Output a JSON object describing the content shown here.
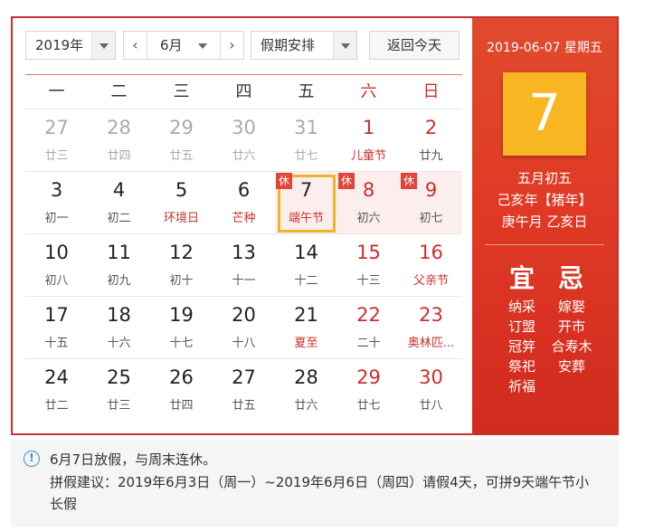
{
  "toolbar": {
    "year": "2019年",
    "month": "6月",
    "prev_icon": "‹",
    "next_icon": "›",
    "holiday": "假期安排",
    "today_button": "返回今天"
  },
  "weekdays": [
    "一",
    "二",
    "三",
    "四",
    "五",
    "六",
    "日"
  ],
  "weeks": [
    [
      {
        "num": "27",
        "sub": "廿三",
        "other": true
      },
      {
        "num": "28",
        "sub": "廿四",
        "other": true
      },
      {
        "num": "29",
        "sub": "廿五",
        "other": true
      },
      {
        "num": "30",
        "sub": "廿六",
        "other": true
      },
      {
        "num": "31",
        "sub": "廿七",
        "other": true
      },
      {
        "num": "1",
        "sub": "儿童节",
        "weekend": true,
        "festival": true
      },
      {
        "num": "2",
        "sub": "廿九",
        "weekend": true
      }
    ],
    [
      {
        "num": "3",
        "sub": "初一"
      },
      {
        "num": "4",
        "sub": "初二"
      },
      {
        "num": "5",
        "sub": "环境日",
        "festival": true
      },
      {
        "num": "6",
        "sub": "芒种",
        "festival": true
      },
      {
        "num": "7",
        "sub": "端午节",
        "festival": true,
        "tag": "休",
        "rest": true,
        "selected": true
      },
      {
        "num": "8",
        "sub": "初六",
        "weekend": true,
        "tag": "休",
        "rest": true
      },
      {
        "num": "9",
        "sub": "初七",
        "weekend": true,
        "tag": "休",
        "rest": true
      }
    ],
    [
      {
        "num": "10",
        "sub": "初八"
      },
      {
        "num": "11",
        "sub": "初九"
      },
      {
        "num": "12",
        "sub": "初十"
      },
      {
        "num": "13",
        "sub": "十一"
      },
      {
        "num": "14",
        "sub": "十二"
      },
      {
        "num": "15",
        "sub": "十三",
        "weekend": true
      },
      {
        "num": "16",
        "sub": "父亲节",
        "weekend": true,
        "festival": true
      }
    ],
    [
      {
        "num": "17",
        "sub": "十五"
      },
      {
        "num": "18",
        "sub": "十六"
      },
      {
        "num": "19",
        "sub": "十七"
      },
      {
        "num": "20",
        "sub": "十八"
      },
      {
        "num": "21",
        "sub": "夏至",
        "festival": true
      },
      {
        "num": "22",
        "sub": "二十",
        "weekend": true
      },
      {
        "num": "23",
        "sub": "奥林匹...",
        "weekend": true,
        "festival": true
      }
    ],
    [
      {
        "num": "24",
        "sub": "廿二"
      },
      {
        "num": "25",
        "sub": "廿三"
      },
      {
        "num": "26",
        "sub": "廿四"
      },
      {
        "num": "27",
        "sub": "廿五"
      },
      {
        "num": "28",
        "sub": "廿六"
      },
      {
        "num": "29",
        "sub": "廿七",
        "weekend": true
      },
      {
        "num": "30",
        "sub": "廿八",
        "weekend": true
      }
    ]
  ],
  "detail": {
    "date": "2019-06-07 星期五",
    "day": "7",
    "lunar_lines": [
      "五月初五",
      "己亥年【猪年】",
      "庚午月 乙亥日"
    ],
    "yi_label": "宜",
    "ji_label": "忌",
    "yi": [
      "纳采",
      "订盟",
      "冠笄",
      "祭祀",
      "祈福"
    ],
    "ji": [
      "嫁娶",
      "开市",
      "合寿木",
      "安葬"
    ]
  },
  "notice": {
    "icon": "!",
    "line1": "6月7日放假，与周末连休。",
    "line2": "拼假建议：2019年6月3日（周一）~2019年6月6日（周四）请假4天，可拼9天端午节小长假"
  },
  "colors": {
    "accent": "#c9302c",
    "panel": "#e03a26",
    "today_block": "#f8b623",
    "selected_border": "#f0b429"
  }
}
